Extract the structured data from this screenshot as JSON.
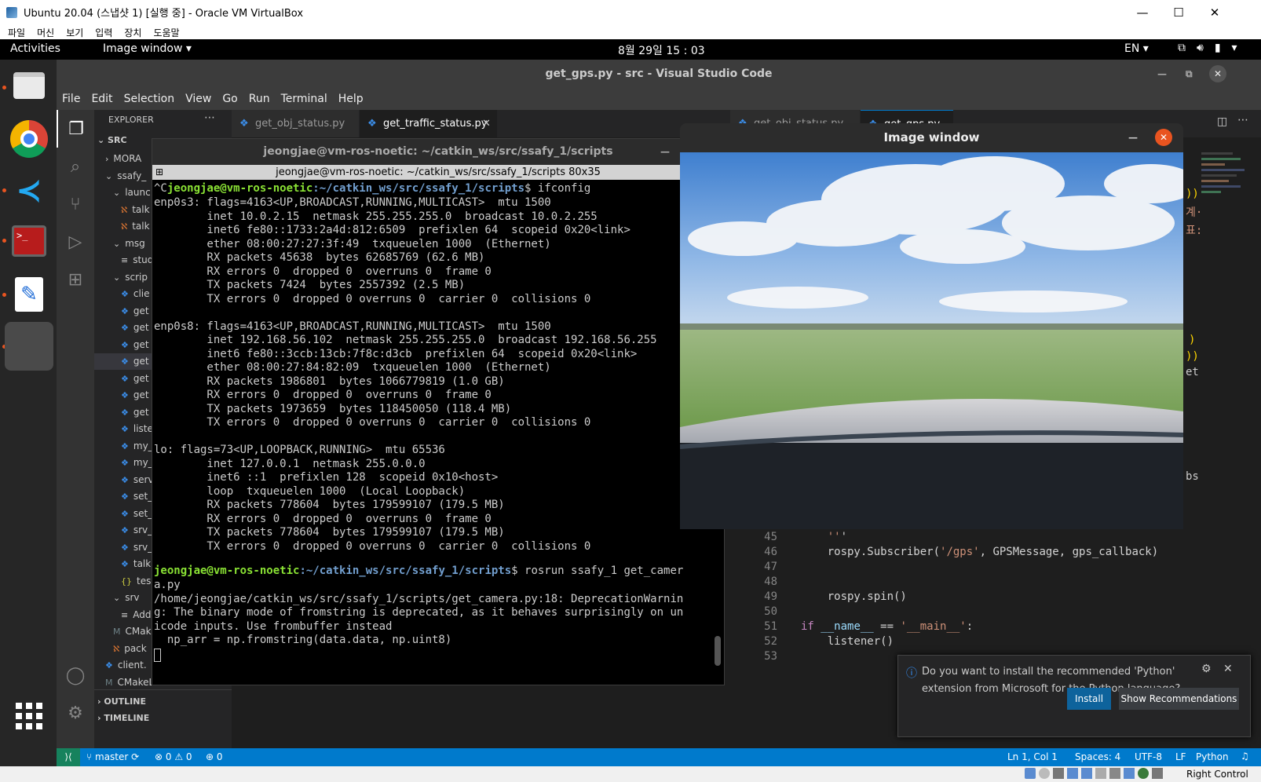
{
  "vbox": {
    "title": "Ubuntu 20.04 (스냅샷 1) [실행 중] - Oracle VM VirtualBox",
    "menu": [
      "파일",
      "머신",
      "보기",
      "입력",
      "장치",
      "도움말"
    ],
    "status_right": "Right Control"
  },
  "gnome": {
    "activities": "Activities",
    "app_menu": "Image window ▾",
    "clock": "8월 29일 15 : 03",
    "lang": "EN ▾"
  },
  "vscode": {
    "title": "get_gps.py - src - Visual Studio Code",
    "menu": [
      "File",
      "Edit",
      "Selection",
      "View",
      "Go",
      "Run",
      "Terminal",
      "Help"
    ],
    "explorer": {
      "header": "EXPLORER",
      "root": "SRC",
      "items": [
        {
          "label": "MORA",
          "indent": 1,
          "kind": "folder-closed"
        },
        {
          "label": "ssafy_",
          "indent": 1,
          "kind": "folder-open"
        },
        {
          "label": "launc",
          "indent": 2,
          "kind": "folder-open"
        },
        {
          "label": "talk",
          "indent": 3,
          "kind": "xml"
        },
        {
          "label": "talk",
          "indent": 3,
          "kind": "xml"
        },
        {
          "label": "msg",
          "indent": 2,
          "kind": "folder-open"
        },
        {
          "label": "stud",
          "indent": 3,
          "kind": "text"
        },
        {
          "label": "scrip",
          "indent": 2,
          "kind": "folder-open"
        },
        {
          "label": "clie",
          "indent": 3,
          "kind": "py"
        },
        {
          "label": "get",
          "indent": 3,
          "kind": "py"
        },
        {
          "label": "get",
          "indent": 3,
          "kind": "py"
        },
        {
          "label": "get",
          "indent": 3,
          "kind": "py"
        },
        {
          "label": "get",
          "indent": 3,
          "kind": "py",
          "selected": true
        },
        {
          "label": "get",
          "indent": 3,
          "kind": "py"
        },
        {
          "label": "get",
          "indent": 3,
          "kind": "py"
        },
        {
          "label": "get",
          "indent": 3,
          "kind": "py"
        },
        {
          "label": "liste",
          "indent": 3,
          "kind": "py"
        },
        {
          "label": "my_",
          "indent": 3,
          "kind": "py"
        },
        {
          "label": "my_",
          "indent": 3,
          "kind": "py"
        },
        {
          "label": "serv",
          "indent": 3,
          "kind": "py"
        },
        {
          "label": "set_",
          "indent": 3,
          "kind": "py"
        },
        {
          "label": "set_",
          "indent": 3,
          "kind": "py"
        },
        {
          "label": "srv_",
          "indent": 3,
          "kind": "py"
        },
        {
          "label": "srv_",
          "indent": 3,
          "kind": "py"
        },
        {
          "label": "talk",
          "indent": 3,
          "kind": "py"
        },
        {
          "label": "tes",
          "indent": 3,
          "kind": "json"
        },
        {
          "label": "srv",
          "indent": 2,
          "kind": "folder-open"
        },
        {
          "label": "Add",
          "indent": 3,
          "kind": "text"
        },
        {
          "label": "CMak",
          "indent": 2,
          "kind": "cmake"
        },
        {
          "label": "pack",
          "indent": 2,
          "kind": "xml"
        },
        {
          "label": "client.",
          "indent": 1,
          "kind": "py"
        },
        {
          "label": "CMakeLists.txt",
          "indent": 1,
          "kind": "cmake"
        }
      ],
      "outline": "OUTLINE",
      "timeline": "TIMELINE"
    },
    "tabs_left": [
      {
        "label": "get_obj_status.py",
        "active": false
      },
      {
        "label": "get_traffic_status.py",
        "active": true
      }
    ],
    "tabs_right": [
      {
        "label": "get_obj_status.py"
      },
      {
        "label": "get_gps.py"
      }
    ],
    "code": [
      {
        "n": "45",
        "text": "    '''"
      },
      {
        "n": "46",
        "text": "    rospy.Subscriber('/gps', GPSMessage, gps_callback)"
      },
      {
        "n": "47",
        "text": ""
      },
      {
        "n": "48",
        "text": ""
      },
      {
        "n": "49",
        "text": "    rospy.spin()"
      },
      {
        "n": "50",
        "text": ""
      },
      {
        "n": "51",
        "text": "if __name__ == '__main__':"
      },
      {
        "n": "52",
        "text": "    listener()"
      },
      {
        "n": "53",
        "text": ""
      }
    ],
    "code_fragments": [
      "))",
      "계·",
      "표:",
      ")",
      "))",
      "et",
      "bs"
    ],
    "status": {
      "branch": "master",
      "errors": "0",
      "warnings": "0",
      "ports": "0",
      "position": "Ln 1, Col 1",
      "spaces": "Spaces: 4",
      "encoding": "UTF-8",
      "eol": "LF",
      "language": "Python"
    },
    "notification": {
      "message": "Do you want to install the recommended 'Python' extension from Microsoft for the Python language?",
      "install": "Install",
      "show": "Show Recommendations"
    }
  },
  "terminal": {
    "title": "jeongjae@vm-ros-noetic: ~/catkin_ws/src/ssafy_1/scripts",
    "subtitle": "jeongjae@vm-ros-noetic: ~/catkin_ws/src/ssafy_1/scripts 80x35",
    "prompt_user": "jeongjae@vm-ros-noetic",
    "prompt_path": ":~/catkin_ws/src/ssafy_1/scripts",
    "first_cmd": "$ ifconfig",
    "lines": [
      "enp0s3: flags=4163<UP,BROADCAST,RUNNING,MULTICAST>  mtu 1500",
      "        inet 10.0.2.15  netmask 255.255.255.0  broadcast 10.0.2.255",
      "        inet6 fe80::1733:2a4d:812:6509  prefixlen 64  scopeid 0x20<link>",
      "        ether 08:00:27:27:3f:49  txqueuelen 1000  (Ethernet)",
      "        RX packets 45638  bytes 62685769 (62.6 MB)",
      "        RX errors 0  dropped 0  overruns 0  frame 0",
      "        TX packets 7424  bytes 2557392 (2.5 MB)",
      "        TX errors 0  dropped 0 overruns 0  carrier 0  collisions 0",
      "",
      "enp0s8: flags=4163<UP,BROADCAST,RUNNING,MULTICAST>  mtu 1500",
      "        inet 192.168.56.102  netmask 255.255.255.0  broadcast 192.168.56.255",
      "        inet6 fe80::3ccb:13cb:7f8c:d3cb  prefixlen 64  scopeid 0x20<link>",
      "        ether 08:00:27:84:82:09  txqueuelen 1000  (Ethernet)",
      "        RX packets 1986801  bytes 1066779819 (1.0 GB)",
      "        RX errors 0  dropped 0  overruns 0  frame 0",
      "        TX packets 1973659  bytes 118450050 (118.4 MB)",
      "        TX errors 0  dropped 0 overruns 0  carrier 0  collisions 0",
      "",
      "lo: flags=73<UP,LOOPBACK,RUNNING>  mtu 65536",
      "        inet 127.0.0.1  netmask 255.0.0.0",
      "        inet6 ::1  prefixlen 128  scopeid 0x10<host>",
      "        loop  txqueuelen 1000  (Local Loopback)",
      "        RX packets 778604  bytes 179599107 (179.5 MB)",
      "        RX errors 0  dropped 0  overruns 0  frame 0",
      "        TX packets 778604  bytes 179599107 (179.5 MB)",
      "        TX errors 0  dropped 0 overruns 0  carrier 0  collisions 0",
      ""
    ],
    "second_cmd": "$ rosrun ssafy_1 get_camer",
    "tail": [
      "a.py",
      "/home/jeongjae/catkin_ws/src/ssafy_1/scripts/get_camera.py:18: DeprecationWarnin",
      "g: The binary mode of fromstring is deprecated, as it behaves surprisingly on un",
      "icode inputs. Use frombuffer instead",
      "  np_arr = np.fromstring(data.data, np.uint8)"
    ]
  },
  "image_window": {
    "title": "Image window"
  },
  "colors": {
    "vscode_blue": "#007acc",
    "ubuntu_orange": "#e95420",
    "prompt_green": "#8ae234",
    "prompt_blue": "#729fcf"
  }
}
